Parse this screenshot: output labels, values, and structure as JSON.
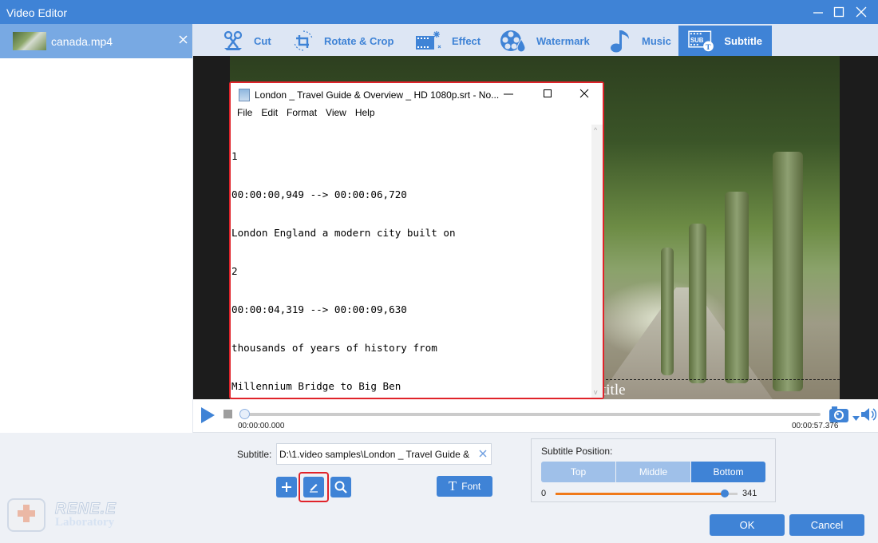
{
  "window": {
    "title": "Video Editor",
    "controls": {
      "minimize": "minimize-icon",
      "maximize": "maximize-icon",
      "close": "close-icon"
    }
  },
  "sidebar": {
    "files": [
      {
        "name": "canada.mp4",
        "close_icon": "close-icon"
      }
    ]
  },
  "toolbar": {
    "tabs": [
      {
        "label": "Cut",
        "icon": "scissors-icon",
        "active": false
      },
      {
        "label": "Rotate & Crop",
        "icon": "rotate-crop-icon",
        "active": false
      },
      {
        "label": "Effect",
        "icon": "effect-film-icon",
        "active": false
      },
      {
        "label": "Watermark",
        "icon": "watermark-icon",
        "active": false
      },
      {
        "label": "Music",
        "icon": "music-note-icon",
        "active": false
      },
      {
        "label": "Subtitle",
        "icon": "subtitle-icon",
        "active": true
      }
    ]
  },
  "preview": {
    "subtitle_preview_text": "title"
  },
  "player": {
    "current_time": "00:00:00.000",
    "total_time": "00:00:57.376",
    "progress_percent": 0
  },
  "notepad": {
    "title": "London _ Travel Guide & Overview _ HD 1080p.srt - No...",
    "menu": [
      "File",
      "Edit",
      "Format",
      "View",
      "Help"
    ],
    "lines": [
      "1",
      "00:00:00,949 --> 00:00:06,720",
      "London England a modern city built on",
      "2",
      "00:00:04,319 --> 00:00:09,630",
      "thousands of years of history from",
      "Millennium Bridge to Big Ben"
    ]
  },
  "subtitle_panel": {
    "label": "Subtitle:",
    "path_value": "D:\\1.video samples\\London _ Travel Guide &",
    "buttons": {
      "add": "plus-icon",
      "edit": "pencil-icon",
      "search": "search-icon"
    },
    "font_label": "Font"
  },
  "position_panel": {
    "title": "Subtitle Position:",
    "options": [
      "Top",
      "Middle",
      "Bottom"
    ],
    "selected": "Bottom",
    "slider_min": "0",
    "slider_max": "341",
    "slider_value_fraction": 0.93
  },
  "branding": {
    "name": "RENE.E",
    "sub": "Laboratory"
  },
  "footer": {
    "ok_label": "OK",
    "cancel_label": "Cancel"
  },
  "colors": {
    "accent": "#3f83d6",
    "highlight": "#e0232a",
    "slider_fill": "#f07a1a"
  }
}
